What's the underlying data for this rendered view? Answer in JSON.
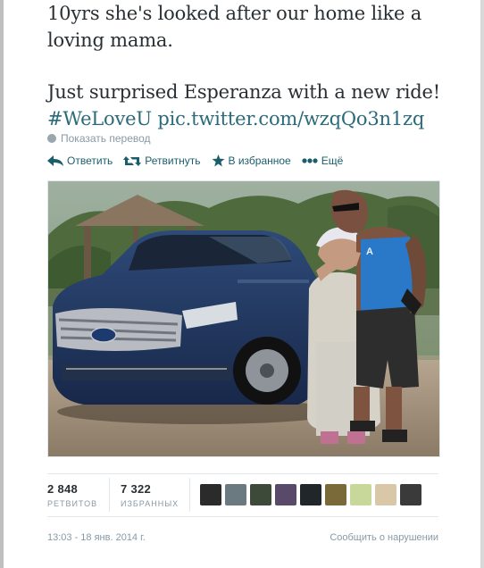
{
  "tweet": {
    "line1": "10yrs she's looked after our home like a",
    "line2": "loving mama.",
    "line3": "Just surprised Esperanza with a new ride!",
    "hashtag": "#WeLoveU",
    "link": "pic.twitter.com/wzqQo3n1zq"
  },
  "translate_label": "Показать перевод",
  "actions": {
    "reply": "Ответить",
    "retweet": "Ретвитнуть",
    "favorite": "В избранное",
    "more": "Ещё"
  },
  "stats": {
    "retweets_count": "2 848",
    "retweets_label": "РЕТВИТОВ",
    "favorites_count": "7 322",
    "favorites_label": "ИЗБРАННЫХ"
  },
  "favoriters_colors": [
    "#2b2b2b",
    "#6a7a80",
    "#3d4a3a",
    "#5a4a6a",
    "#20262a",
    "#7a6a3a",
    "#c8d89a",
    "#d8c8a8",
    "#3a3a3a"
  ],
  "timestamp": "13:03 - 18 янв. 2014 г.",
  "report_label": "Сообщить о нарушении",
  "colors": {
    "link": "#2a6a7a",
    "action": "#1a5e6b",
    "muted": "#8899a6"
  }
}
